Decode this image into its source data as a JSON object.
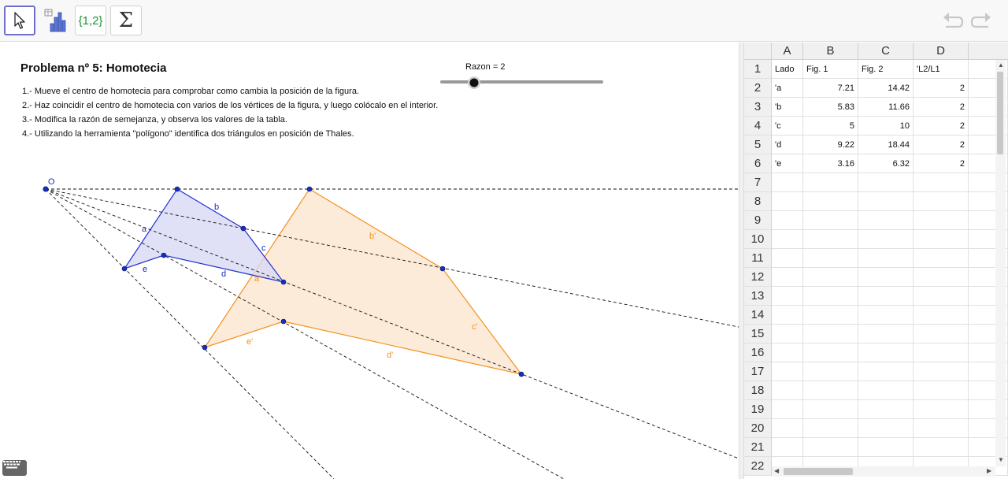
{
  "toolbar": {
    "tools": [
      {
        "name": "move-tool",
        "icon": "cursor-arrow-icon"
      },
      {
        "name": "histogram-tool",
        "icon": "bar-chart-icon"
      },
      {
        "name": "list-tool",
        "label": "{1,2}"
      },
      {
        "name": "sum-tool",
        "label": "Σ"
      }
    ],
    "undo_icon": "undo-icon",
    "redo_icon": "redo-icon"
  },
  "problem": {
    "title": "Problema nº 5: Homotecia",
    "instructions": [
      "1.- Mueve el centro de homotecia para comprobar como cambia la posición de la figura.",
      "2.- Haz coincidir el centro de homotecia con varios de los vértices de la figura, y luego colócalo en el interior.",
      "3.- Modifica la razón de semejanza, y observa los valores de la tabla.",
      "4.- Utilizando la herramienta \"polígono\" identifica dos triángulos en posición de Thales."
    ]
  },
  "slider": {
    "label": "Razon = 2",
    "value": 2,
    "min": 1,
    "max": 5
  },
  "figure": {
    "center_label": "O",
    "original_side_labels": [
      "a",
      "b",
      "c",
      "d",
      "e"
    ],
    "image_side_labels": [
      "a'",
      "b'",
      "c'",
      "d'",
      "e'"
    ],
    "colors": {
      "original_stroke": "#2233cc",
      "original_fill": "#d8daf5",
      "image_stroke": "#f2921e",
      "image_fill": "#fde6d0",
      "ray": "#111111"
    }
  },
  "spreadsheet": {
    "columns": [
      "A",
      "B",
      "C",
      "D",
      ""
    ],
    "rows": [
      {
        "n": "1",
        "cells": [
          "Lado",
          "Fig. 1",
          "Fig. 2",
          "'L2/L1"
        ]
      },
      {
        "n": "2",
        "cells": [
          "'a",
          "7.21",
          "14.42",
          "2"
        ]
      },
      {
        "n": "3",
        "cells": [
          "'b",
          "5.83",
          "11.66",
          "2"
        ]
      },
      {
        "n": "4",
        "cells": [
          "'c",
          "5",
          "10",
          "2"
        ]
      },
      {
        "n": "5",
        "cells": [
          "'d",
          "9.22",
          "18.44",
          "2"
        ]
      },
      {
        "n": "6",
        "cells": [
          "'e",
          "3.16",
          "6.32",
          "2"
        ]
      },
      {
        "n": "7",
        "cells": [
          "",
          "",
          "",
          ""
        ]
      },
      {
        "n": "8",
        "cells": [
          "",
          "",
          "",
          ""
        ]
      },
      {
        "n": "9",
        "cells": [
          "",
          "",
          "",
          ""
        ]
      },
      {
        "n": "10",
        "cells": [
          "",
          "",
          "",
          ""
        ]
      },
      {
        "n": "11",
        "cells": [
          "",
          "",
          "",
          ""
        ]
      },
      {
        "n": "12",
        "cells": [
          "",
          "",
          "",
          ""
        ]
      },
      {
        "n": "13",
        "cells": [
          "",
          "",
          "",
          ""
        ]
      },
      {
        "n": "14",
        "cells": [
          "",
          "",
          "",
          ""
        ]
      },
      {
        "n": "15",
        "cells": [
          "",
          "",
          "",
          ""
        ]
      },
      {
        "n": "16",
        "cells": [
          "",
          "",
          "",
          ""
        ]
      },
      {
        "n": "17",
        "cells": [
          "",
          "",
          "",
          ""
        ]
      },
      {
        "n": "18",
        "cells": [
          "",
          "",
          "",
          ""
        ]
      },
      {
        "n": "19",
        "cells": [
          "",
          "",
          "",
          ""
        ]
      },
      {
        "n": "20",
        "cells": [
          "",
          "",
          "",
          ""
        ]
      },
      {
        "n": "21",
        "cells": [
          "",
          "",
          "",
          ""
        ]
      },
      {
        "n": "22",
        "cells": [
          "",
          "",
          "",
          ""
        ]
      }
    ]
  },
  "keyboard_icon": "keyboard-icon"
}
